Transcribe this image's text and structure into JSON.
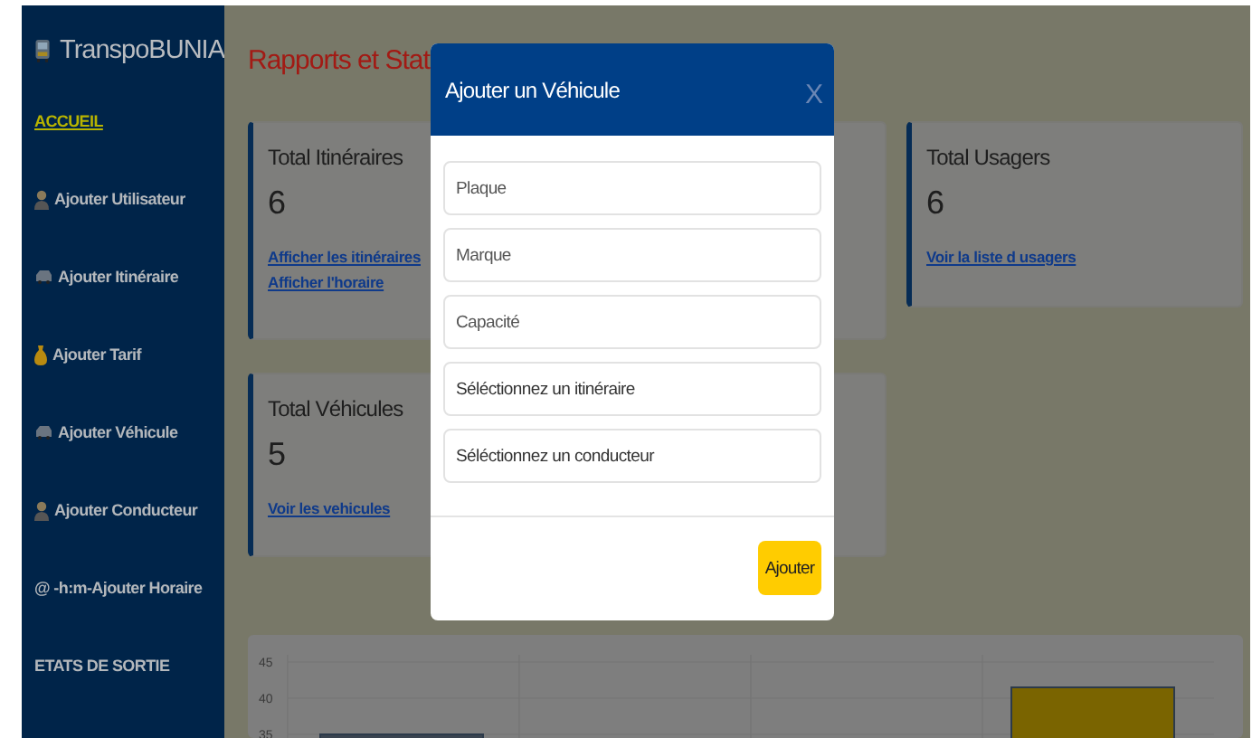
{
  "sidebar": {
    "brand": "TranspoBUNIA",
    "items": [
      {
        "label": "ACCUEIL",
        "selected": true
      },
      {
        "label": "Ajouter Utilisateur",
        "selected": false
      },
      {
        "label": "Ajouter Itinéraire",
        "selected": false
      },
      {
        "label": "Ajouter Tarif",
        "selected": false
      },
      {
        "label": "Ajouter Véhicule",
        "selected": false
      },
      {
        "label": "Ajouter Conducteur",
        "selected": false
      },
      {
        "label": "@ -h:m-Ajouter Horaire",
        "selected": false
      },
      {
        "label": "ETATS DE SORTIE",
        "selected": false
      }
    ]
  },
  "page_title": "Rapports et Stat",
  "cards": [
    {
      "title": "Total Itinéraires",
      "value": "6",
      "links": [
        "Afficher les itinéraires",
        "Afficher l'horaire"
      ]
    },
    {
      "title": "Total Usagers",
      "value": "6",
      "links": [
        "Voir la liste d usagers"
      ]
    },
    {
      "title": "Total Véhicules",
      "value": "5",
      "links": [
        "Voir les vehicules"
      ]
    }
  ],
  "chart": {
    "y_axis_labels": [
      "45",
      "40",
      "35"
    ]
  },
  "modal": {
    "title": "Ajouter un Véhicule",
    "close": "X",
    "fields": [
      {
        "kind": "input",
        "placeholder": "Plaque"
      },
      {
        "kind": "input",
        "placeholder": "Marque"
      },
      {
        "kind": "input",
        "placeholder": "Capacité"
      },
      {
        "kind": "select",
        "placeholder": "Séléctionnez un itinéraire"
      },
      {
        "kind": "select",
        "placeholder": "Séléctionnez un conducteur"
      }
    ],
    "submit": "Ajouter"
  }
}
